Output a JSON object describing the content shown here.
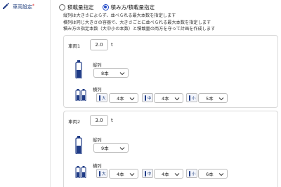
{
  "sidebar": {
    "item_label": "車両設定",
    "required_mark": "*"
  },
  "mode": {
    "options": [
      {
        "label": "積載量指定",
        "selected": false
      },
      {
        "label": "積み方/積載量指定",
        "selected": true
      }
    ]
  },
  "description": {
    "lines": [
      "縦列は大きさによらず、並べられる最大本数を指定します",
      "横列は同じ大きさの容器で、大きさごとに並べられる最大本数を指定します",
      "積み方の指定本数（大中小の本数）と積載量の両方を守って計画を作成します"
    ]
  },
  "vehicles": [
    {
      "label": "車両1",
      "capacity": "2.0",
      "unit": "t",
      "vertical_label": "縦列",
      "vertical_value": "8本",
      "horizontal_label": "横列",
      "sizes": [
        {
          "size": "大",
          "value": "4本"
        },
        {
          "size": "中",
          "value": "4本"
        },
        {
          "size": "小",
          "value": "5本"
        }
      ]
    },
    {
      "label": "車両2",
      "capacity": "3.0",
      "unit": "t",
      "vertical_label": "縦列",
      "vertical_value": "9本",
      "horizontal_label": "横列",
      "sizes": [
        {
          "size": "大",
          "value": "4本"
        },
        {
          "size": "中",
          "value": "4本"
        },
        {
          "size": "小",
          "value": "6本"
        }
      ]
    }
  ],
  "colors": {
    "accent": "#1f47c6",
    "navy": "#1f3b86"
  }
}
